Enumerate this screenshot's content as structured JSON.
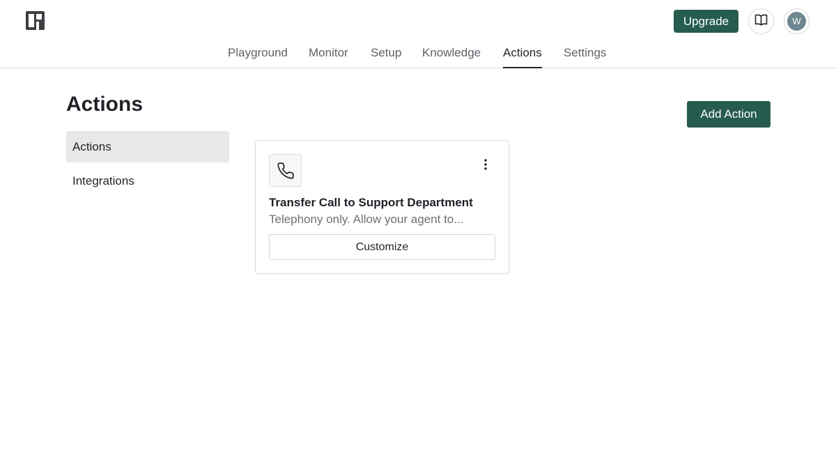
{
  "header": {
    "logo_icon": "brand-logo-icon",
    "upgrade_label": "Upgrade",
    "docs_icon": "book-icon",
    "avatar_initial": "W",
    "accent_color": "#255c4e"
  },
  "nav": {
    "tabs": [
      {
        "label": "Playground"
      },
      {
        "label": "Monitor"
      },
      {
        "label": "Setup"
      },
      {
        "label": "Knowledge"
      },
      {
        "label": "Actions",
        "active": true
      },
      {
        "label": "Settings"
      }
    ]
  },
  "page": {
    "title": "Actions",
    "add_button_label": "Add Action"
  },
  "subnav": {
    "items": [
      {
        "label": "Actions",
        "active": true
      },
      {
        "label": "Integrations"
      }
    ]
  },
  "actions": [
    {
      "icon": "phone-icon",
      "title": "Transfer Call to Support Department",
      "description": "Telephony only. Allow your agent to...",
      "button_label": "Customize"
    }
  ]
}
